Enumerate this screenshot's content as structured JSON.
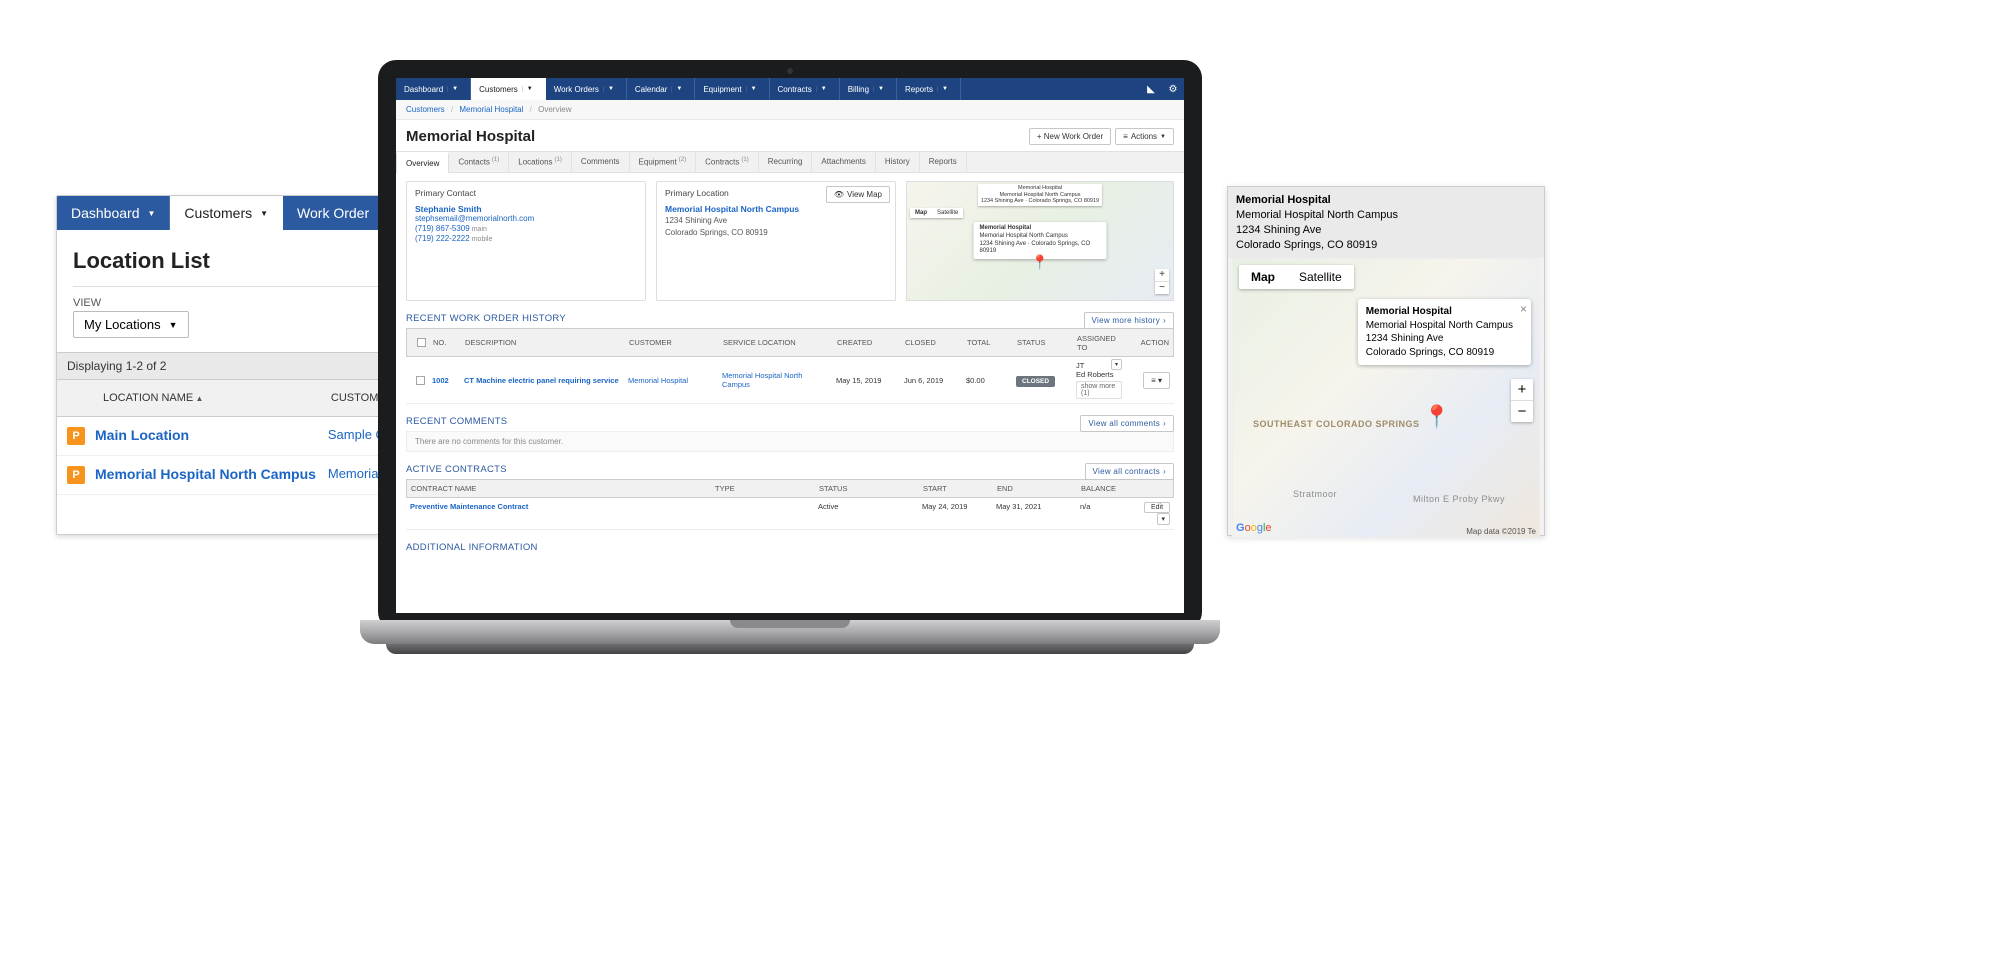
{
  "left_panel": {
    "tabs": [
      "Dashboard",
      "Customers",
      "Work Order"
    ],
    "active_tab_index": 1,
    "title": "Location List",
    "view_label": "VIEW",
    "view_dropdown": "My Locations",
    "displaying": "Displaying 1-2 of 2",
    "columns": [
      "LOCATION NAME",
      "CUSTOMER"
    ],
    "rows": [
      {
        "badge": "P",
        "location": "Main Location",
        "customer": "Sample Cu"
      },
      {
        "badge": "P",
        "location": "Memorial Hospital North Campus",
        "customer": "Memorial"
      }
    ]
  },
  "right_panel": {
    "header": {
      "title": "Memorial Hospital",
      "sub": "Memorial Hospital North Campus",
      "addr1": "1234 Shining Ave",
      "addr2": "Colorado Springs, CO 80919"
    },
    "map_buttons": [
      "Map",
      "Satellite"
    ],
    "tooltip": {
      "title": "Memorial Hospital",
      "sub": "Memorial Hospital North Campus",
      "addr1": "1234 Shining Ave",
      "addr2": "Colorado Springs, CO 80919"
    },
    "road_labels": [
      "SOUTHEAST COLORADO SPRINGS",
      "Stratmoor",
      "Milton E Proby Pkwy"
    ],
    "google": "Google",
    "mapdata": "Map data ©2019   Te"
  },
  "app": {
    "nav": [
      "Dashboard",
      "Customers",
      "Work Orders",
      "Calendar",
      "Equipment",
      "Contracts",
      "Billing",
      "Reports"
    ],
    "active_nav_index": 1,
    "top_icons": [
      "bookmark-icon",
      "gear-icon"
    ],
    "breadcrumbs": [
      "Customers",
      "Memorial Hospital",
      "Overview"
    ],
    "page_title": "Memorial Hospital",
    "hdr_buttons": {
      "new_wo": "+ New Work Order",
      "actions": "Actions"
    },
    "subtabs": [
      {
        "label": "Overview",
        "badge": ""
      },
      {
        "label": "Contacts",
        "badge": "(1)"
      },
      {
        "label": "Locations",
        "badge": "(1)"
      },
      {
        "label": "Comments",
        "badge": ""
      },
      {
        "label": "Equipment",
        "badge": "(2)"
      },
      {
        "label": "Contracts",
        "badge": "(1)"
      },
      {
        "label": "Recurring",
        "badge": ""
      },
      {
        "label": "Attachments",
        "badge": ""
      },
      {
        "label": "History",
        "badge": ""
      },
      {
        "label": "Reports",
        "badge": ""
      }
    ],
    "primary_contact": {
      "title": "Primary Contact",
      "name": "Stephanie Smith",
      "email": "stephsemail@memorialnorth.com",
      "phone_main": "(719) 867-5309",
      "phone_main_label": "main",
      "phone_mobile": "(719) 222-2222",
      "phone_mobile_label": "mobile"
    },
    "primary_location": {
      "title": "Primary Location",
      "view_map": "View Map",
      "name": "Memorial Hospital North Campus",
      "addr1": "1234 Shining Ave",
      "addr2": "Colorado Springs, CO 80919"
    },
    "mini_map": {
      "buttons": [
        "Map",
        "Satellite"
      ],
      "head_title": "Memorial Hospital",
      "head_sub": "Memorial Hospital North Campus",
      "head_addr": "1234 Shining Ave · Colorado Springs, CO 80919",
      "tooltip_title": "Memorial Hospital",
      "tooltip_sub": "Memorial Hospital North Campus",
      "tooltip_addr": "1234 Shining Ave · Colorado Springs, CO 80919"
    },
    "recent_wo": {
      "title": "RECENT WORK ORDER HISTORY",
      "more_btn": "View more history",
      "cols": [
        "NO.",
        "DESCRIPTION",
        "CUSTOMER",
        "SERVICE LOCATION",
        "CREATED",
        "CLOSED",
        "TOTAL",
        "STATUS",
        "ASSIGNED TO",
        "ACTION"
      ],
      "row": {
        "no": "1002",
        "desc": "CT Machine electric panel requiring service",
        "customer": "Memorial Hospital",
        "service_loc": "Memorial Hospital North Campus",
        "created": "May 15, 2019",
        "closed": "Jun 6, 2019",
        "total": "$0.00",
        "status": "CLOSED",
        "assigned": [
          "JT",
          "Ed Roberts"
        ],
        "show_more": "show more (1)"
      }
    },
    "recent_comments": {
      "title": "RECENT COMMENTS",
      "more_btn": "View all comments",
      "empty": "There are no comments for this customer."
    },
    "active_contracts": {
      "title": "ACTIVE CONTRACTS",
      "more_btn": "View all contracts",
      "cols": [
        "CONTRACT NAME",
        "TYPE",
        "STATUS",
        "START",
        "END",
        "BALANCE",
        ""
      ],
      "row": {
        "name": "Preventive Maintenance Contract",
        "type": "",
        "status": "Active",
        "start": "May 24, 2019",
        "end": "May 31, 2021",
        "balance": "n/a",
        "edit": "Edit"
      }
    },
    "additional_info": {
      "title": "ADDITIONAL INFORMATION"
    }
  }
}
